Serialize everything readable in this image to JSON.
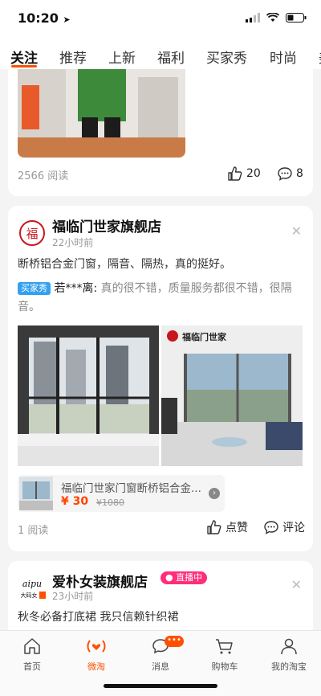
{
  "status": {
    "time": "10:20"
  },
  "tabs": [
    "关注",
    "推荐",
    "上新",
    "福利",
    "买家秀",
    "时尚",
    "美"
  ],
  "card1": {
    "reads": "2566 阅读",
    "likes": "20",
    "comments": "8"
  },
  "card2": {
    "logo_text": "福",
    "store_name": "福临门世家旗舰店",
    "time": "22小时前",
    "text": "断桥铝合金门窗，隔音、隔热，真的挺好。",
    "buyer_badge": "买家秀",
    "buyer_name": "若***离:",
    "buyer_comment": "真的很不错，质量服务都很不错，很隔音。",
    "image_brand": "福临门世家",
    "product": {
      "title": "福临门世家门窗断桥铝合金...",
      "price": "¥ 30",
      "orig_price": "¥1080"
    },
    "reads": "1 阅读",
    "like_label": "点赞",
    "comment_label": "评论"
  },
  "card3": {
    "logo_text": "aipu",
    "logo_sub": "大码女",
    "store_name": "爱朴女装旗舰店",
    "live_badge": "直播中",
    "time": "23小时前",
    "text": "秋冬必备打底裙 我只信赖针织裙"
  },
  "nav": [
    {
      "label": "首页",
      "icon": "home-icon"
    },
    {
      "label": "微淘",
      "icon": "weitao-icon"
    },
    {
      "label": "消息",
      "icon": "message-icon",
      "badge": "•••"
    },
    {
      "label": "购物车",
      "icon": "cart-icon"
    },
    {
      "label": "我的淘宝",
      "icon": "profile-icon"
    }
  ],
  "colors": {
    "accent": "#ff5000",
    "live": "#ff2e7a",
    "buyer_badge": "#33a0f0",
    "price": "#ff4400"
  }
}
